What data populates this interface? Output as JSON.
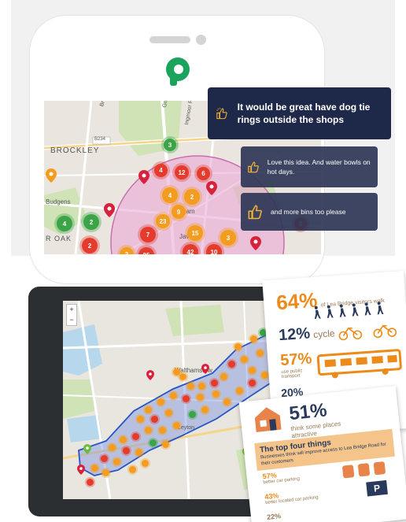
{
  "phone_map": {
    "labels": [
      "BROCKLEY",
      "Budgens",
      "B234",
      "Grinling Rd",
      "Ingmoor Rd",
      "Javen",
      "R OAK",
      "Br",
      "ham"
    ],
    "clusters": [
      {
        "n": "3",
        "c": "green"
      },
      {
        "n": "4",
        "c": "red"
      },
      {
        "n": "12",
        "c": "red"
      },
      {
        "n": "6",
        "c": "red"
      },
      {
        "n": "4",
        "c": "orange"
      },
      {
        "n": "2",
        "c": "orange"
      },
      {
        "n": "9",
        "c": "orange"
      },
      {
        "n": "23",
        "c": "orange"
      },
      {
        "n": "4",
        "c": "green"
      },
      {
        "n": "2",
        "c": "green"
      },
      {
        "n": "2",
        "c": "red"
      },
      {
        "n": "7",
        "c": "red"
      },
      {
        "n": "15",
        "c": "orange"
      },
      {
        "n": "3",
        "c": "orange"
      },
      {
        "n": "42",
        "c": "red"
      },
      {
        "n": "10",
        "c": "red"
      },
      {
        "n": "25",
        "c": "red"
      },
      {
        "n": "3",
        "c": "orange"
      },
      {
        "n": "9",
        "c": "red"
      }
    ]
  },
  "comments": {
    "main": "It would be great have dog tie rings outside the shops",
    "reply1": "Love this idea.  And water bowls on hot days.",
    "reply2": "and more bins too please"
  },
  "tablet_map": {
    "labels": [
      "Walthamstow",
      "Leyton"
    ],
    "zoom_in": "+",
    "zoom_out": "−"
  },
  "infographic": {
    "stat1_value": "64%",
    "stat1_text": "of Lea Bridge visitors walk",
    "stat2_value": "12%",
    "stat2_text": "cycle",
    "stat3_value": "57%",
    "stat3_text": "use public transport",
    "stat4_value": "20%",
    "stat5_value": "51%",
    "stat5_text": "think some places attractive",
    "top_four_title": "The top four things",
    "top_four_sub": "Businesses think will improve access to Lea Bridge Road for their customers",
    "row1_value": "57%",
    "row1_text": "better car parking",
    "row2_value": "43%",
    "row2_text": "better located car parking",
    "row3_value": "22%",
    "parking_sign": "P"
  },
  "colors": {
    "brand_green": "#1aa35a",
    "bubble_dark": "#1e2848",
    "cluster_red": "#e53b2c",
    "cluster_orange": "#f39c1f",
    "cluster_green": "#3aa447",
    "zone_pink": "#e9a3d4",
    "zone_blue": "#2656c8"
  }
}
